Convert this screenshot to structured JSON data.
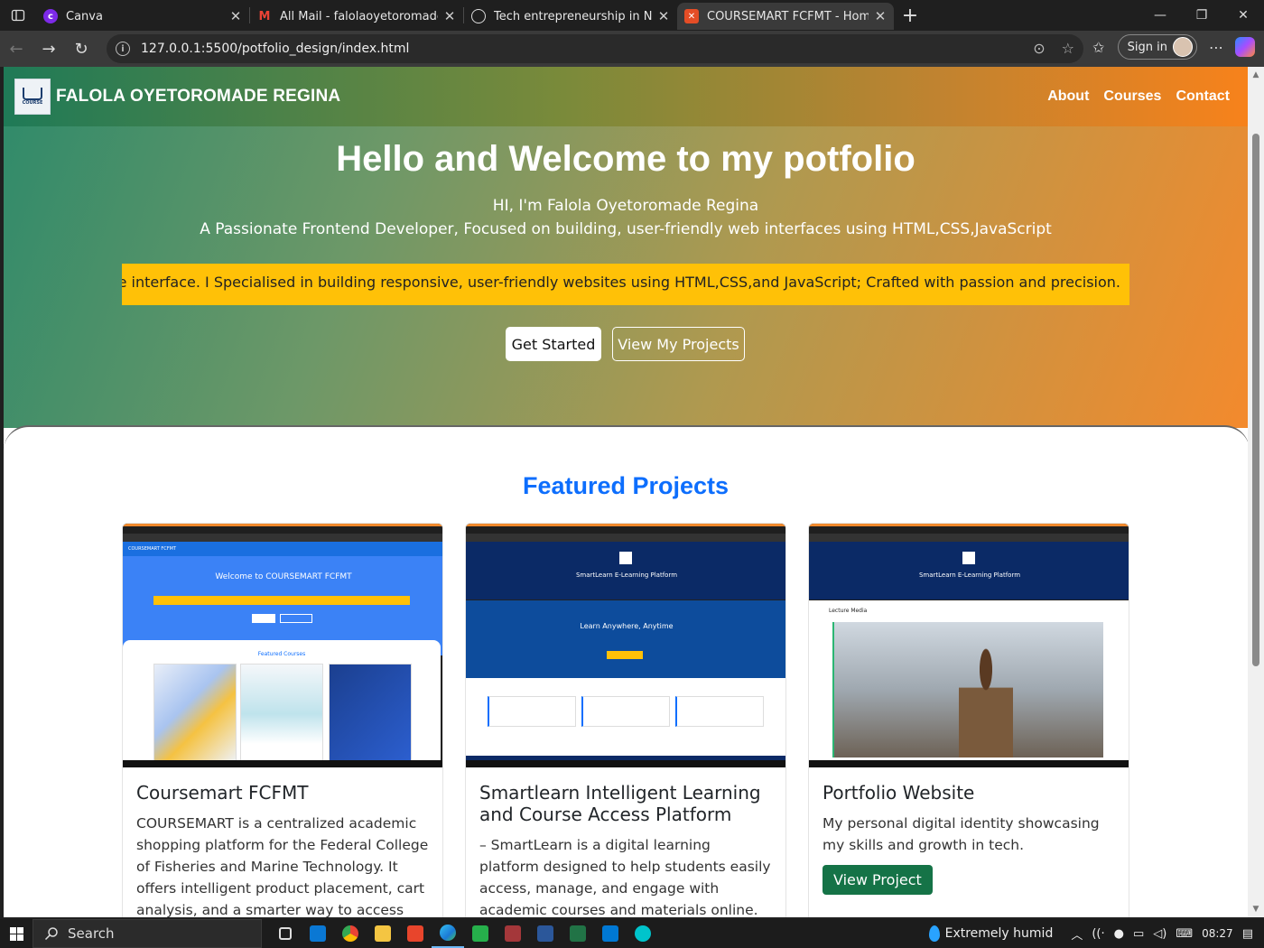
{
  "browser": {
    "tabs": [
      {
        "title": "Canva",
        "icon": "canva-icon",
        "color": "#7d2ae8"
      },
      {
        "title": "All Mail - falolaoyetoromade@gm",
        "icon": "gmail-icon",
        "color": "#ea4335"
      },
      {
        "title": "Tech entrepreneurship in Nigeria",
        "icon": "chatgpt-icon",
        "color": "#dddddd"
      },
      {
        "title": "COURSEMART FCFMT - Home",
        "icon": "html-file-icon",
        "color": "#e44d26"
      }
    ],
    "active_tab": 3,
    "url": "127.0.0.1:5500/potfolio_design/index.html",
    "sign_in_label": "Sign in"
  },
  "site": {
    "brand": "FALOLA OYETOROMADE REGINA",
    "nav": [
      "About",
      "Courses",
      "Contact"
    ],
    "hero": {
      "title": "Hello and Welcome to my potfolio",
      "subtitle1": "HI, I'm Falola Oyetoromade Regina",
      "subtitle2": "A Passionate Frontend Developer, Focused on building, user-friendly web interfaces using HTML,CSS,JavaScript",
      "marquee": "signs, and interactive interface. I Specialised in building responsive, user-friendly websites using HTML,CSS,and JavaScript; Crafted with passion and precision.",
      "btn_primary": "Get Started",
      "btn_secondary": "View My Projects"
    },
    "section_title": "Featured Projects",
    "projects": [
      {
        "title": "Coursemart FCFMT",
        "text": "COURSEMART is a centralized academic shopping platform for the Federal College of Fisheries and Marine Technology. It offers intelligent product placement, cart analysis, and a smarter way to access college courses",
        "shot_title": "Welcome to COURSEMART FCFMT",
        "shot_section": "Featured Courses"
      },
      {
        "title": "Smartlearn Intelligent Learning and Course Access Platform",
        "text": "– SmartLearn is a digital learning platform designed to help students easily access, manage, and engage with academic courses and materials online. It provides personalized",
        "shot_title": "SmartLearn E-Learning Platform",
        "shot_hero": "Learn Anywhere, Anytime"
      },
      {
        "title": "Portfolio Website",
        "text": "My personal digital identity showcasing my skills and growth in tech.",
        "button": "View Project",
        "shot_title": "SmartLearn E-Learning Platform",
        "shot_section": "Lecture Media"
      }
    ]
  },
  "taskbar": {
    "search_label": "Search",
    "weather": "Extremely humid",
    "time": "08:27"
  },
  "colors": {
    "accent_blue": "#0d6efd",
    "marquee_yellow": "#ffc107",
    "view_button_green": "#157347",
    "nav_orange": "#f7821b",
    "nav_green": "#1f7a57"
  }
}
